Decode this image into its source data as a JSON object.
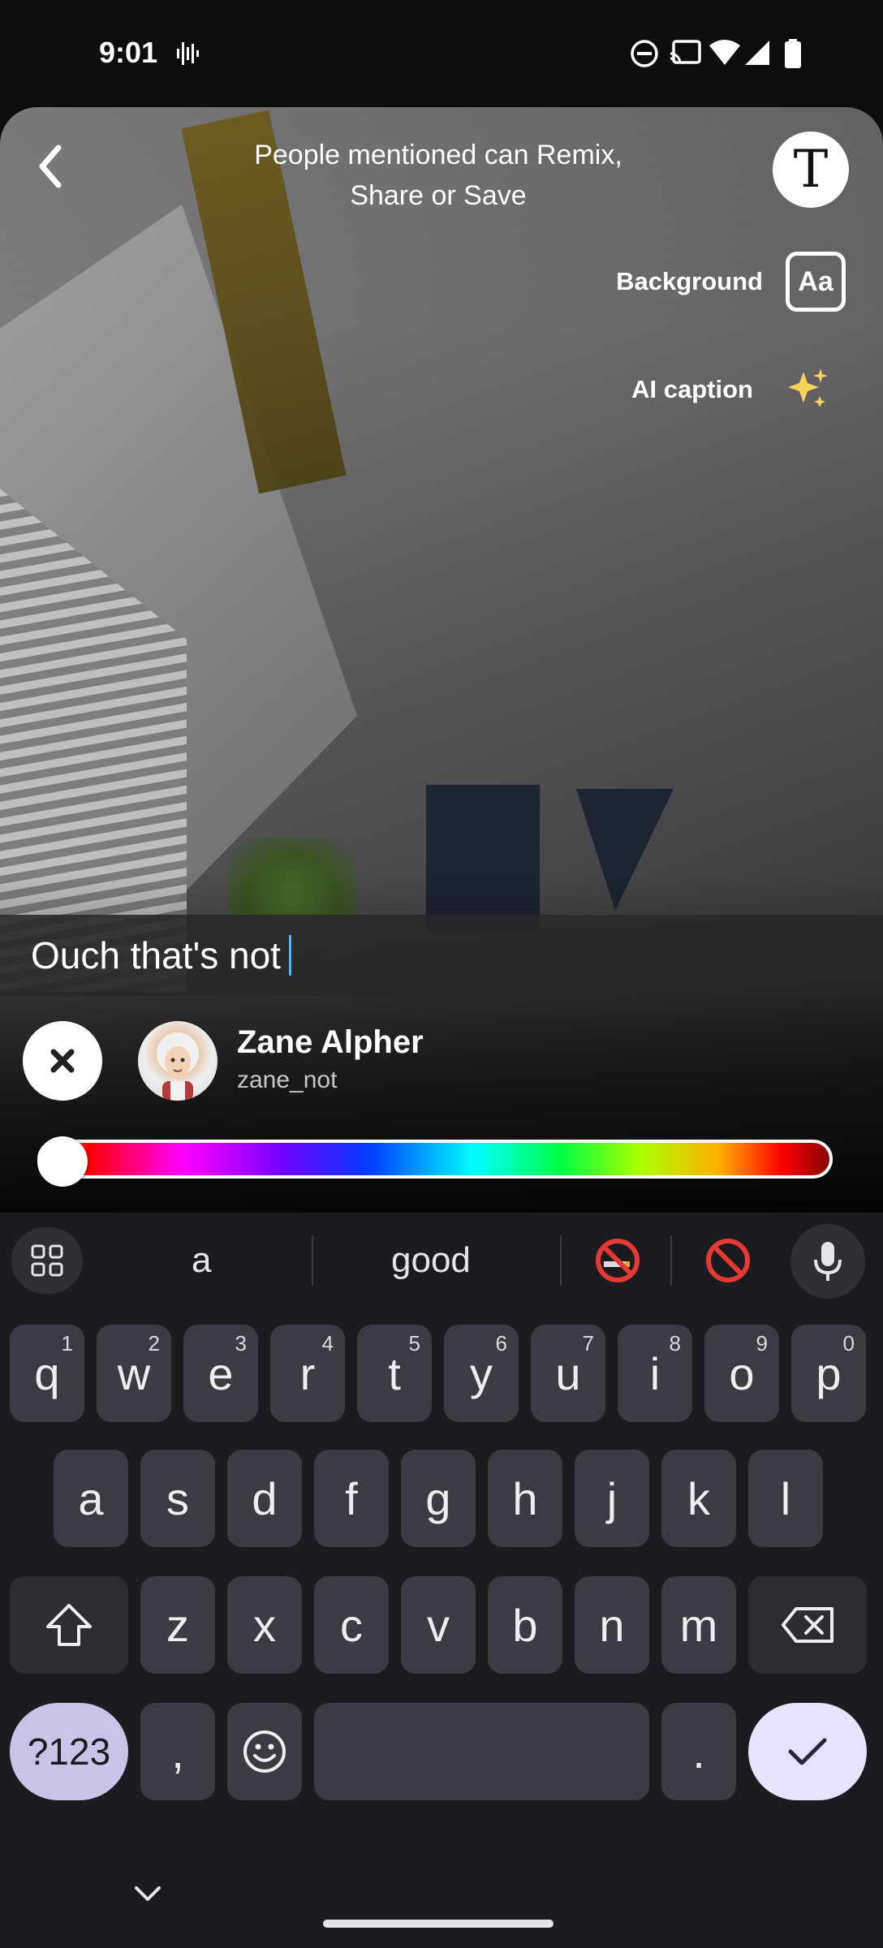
{
  "status_bar": {
    "time": "9:01",
    "icons": [
      "voice-wave-icon",
      "do-not-disturb-icon",
      "cast-icon",
      "wifi-icon",
      "signal-icon",
      "battery-icon"
    ]
  },
  "editor": {
    "mention_note": "People mentioned can Remix, Share or Save",
    "text_tool_glyph": "T",
    "background_label": "Background",
    "background_icon_text": "Aa",
    "ai_caption_label": "AI caption",
    "caption_text": "Ouch that's not",
    "mention": {
      "name": "Zane Alpher",
      "username": "zane_not"
    },
    "color_slider_position": 0.0
  },
  "keyboard": {
    "suggestions": [
      "a",
      "good"
    ],
    "rows": [
      [
        {
          "k": "q",
          "s": "1"
        },
        {
          "k": "w",
          "s": "2"
        },
        {
          "k": "e",
          "s": "3"
        },
        {
          "k": "r",
          "s": "4"
        },
        {
          "k": "t",
          "s": "5"
        },
        {
          "k": "y",
          "s": "6"
        },
        {
          "k": "u",
          "s": "7"
        },
        {
          "k": "i",
          "s": "8"
        },
        {
          "k": "o",
          "s": "9"
        },
        {
          "k": "p",
          "s": "0"
        }
      ],
      [
        "a",
        "s",
        "d",
        "f",
        "g",
        "h",
        "j",
        "k",
        "l"
      ],
      [
        "z",
        "x",
        "c",
        "v",
        "b",
        "n",
        "m"
      ]
    ],
    "symbols_label": "?123",
    "comma": ",",
    "period": "."
  },
  "colors": {
    "accent_cursor": "#4fb6ff",
    "keyboard_bg": "#1b1b20",
    "key_bg": "#3b3b43",
    "confirm_key_bg": "#e7e2ff"
  }
}
